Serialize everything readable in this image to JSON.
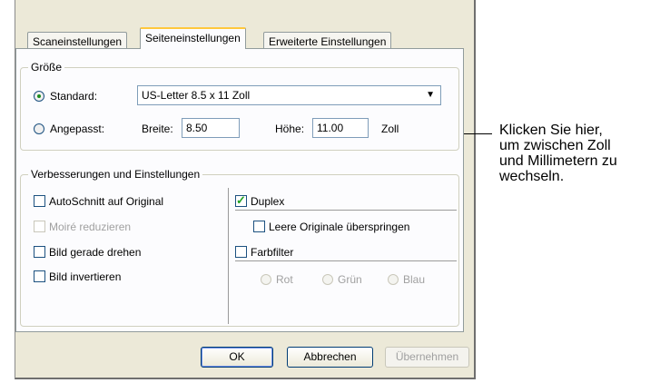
{
  "tabs": [
    {
      "label": "Scaneinstellungen"
    },
    {
      "label": "Seiteneinstellungen"
    },
    {
      "label": "Erweiterte Einstellungen"
    }
  ],
  "size_group": {
    "title": "Größe",
    "standard_label": "Standard:",
    "standard_value": "US-Letter 8.5 x 11 Zoll",
    "custom_label": "Angepasst:",
    "width_label": "Breite:",
    "width_value": "8.50",
    "height_label": "Höhe:",
    "height_value": "11.00",
    "unit_label": "Zoll"
  },
  "enhance_group": {
    "title": "Verbesserungen und Einstellungen",
    "autocrop": "AutoSchnitt auf Original",
    "moire": "Moiré reduzieren",
    "deskew": "Bild gerade drehen",
    "invert": "Bild invertieren",
    "duplex": "Duplex",
    "skip_blank": "Leere Originale überspringen",
    "color_filter": "Farbfilter",
    "red": "Rot",
    "green": "Grün",
    "blue": "Blau"
  },
  "buttons": {
    "ok": "OK",
    "cancel": "Abbrechen",
    "apply": "Übernehmen"
  },
  "callout": {
    "line1": "Klicken Sie hier,",
    "line2": "um zwischen Zoll",
    "line3": "und Millimetern zu",
    "line4": "wechseln."
  },
  "state": {
    "size_mode": "standard",
    "duplex_checked": true
  }
}
